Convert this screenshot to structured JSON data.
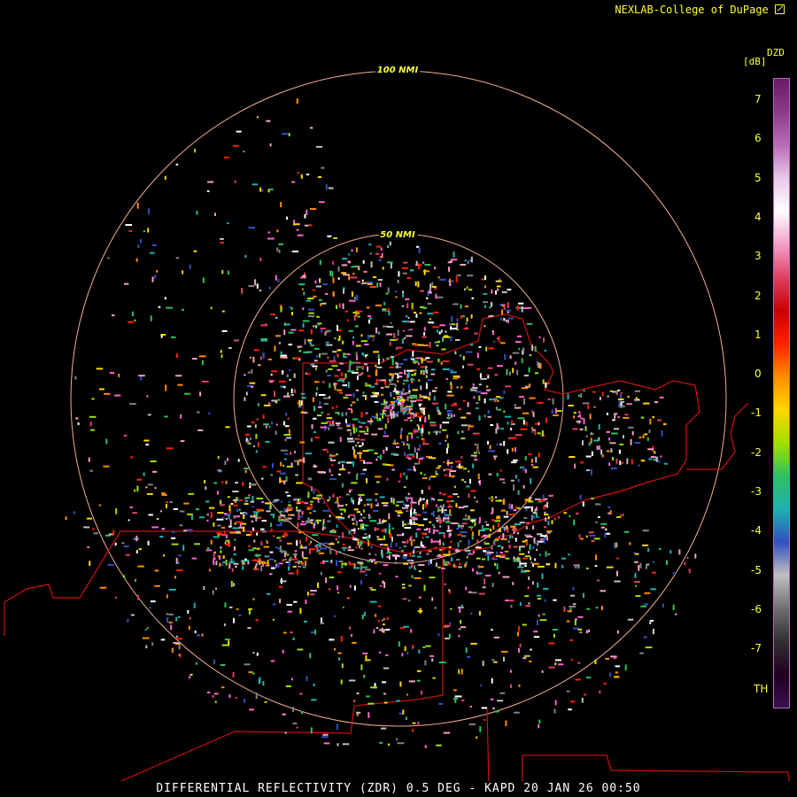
{
  "credit": "NEXLAB-College of DuPage",
  "credit_icon": "external-link-icon",
  "caption": "DIFFERENTIAL REFLECTIVITY (ZDR) 0.5 DEG - KAPD 20 JAN 26 00:50",
  "range_rings": [
    {
      "label": "100 NMI"
    },
    {
      "label": "50 NMI"
    }
  ],
  "legend": {
    "product": "DZD",
    "units": "[dB]",
    "ticks": [
      "7",
      "6",
      "5",
      "4",
      "3",
      "2",
      "1",
      "0",
      "-1",
      "-2",
      "-3",
      "-4",
      "-5",
      "-6",
      "-7"
    ],
    "threshold_label": "TH",
    "colors": [
      "#6a1a6a",
      "#8c3a8c",
      "#b86bb8",
      "#e8c8e8",
      "#ffffff",
      "#f4a0c8",
      "#e04060",
      "#c80000",
      "#ff2000",
      "#ff8c00",
      "#ffd700",
      "#a0e000",
      "#30c060",
      "#20b0b0",
      "#3050c0",
      "#c0c0c0",
      "#707070",
      "#303030",
      "#200020",
      "#3a1050"
    ]
  },
  "colors": {
    "ring": "#f0b090",
    "ring_label": "#ffff33",
    "boundary": "#d01010",
    "text": "#ffff33"
  }
}
